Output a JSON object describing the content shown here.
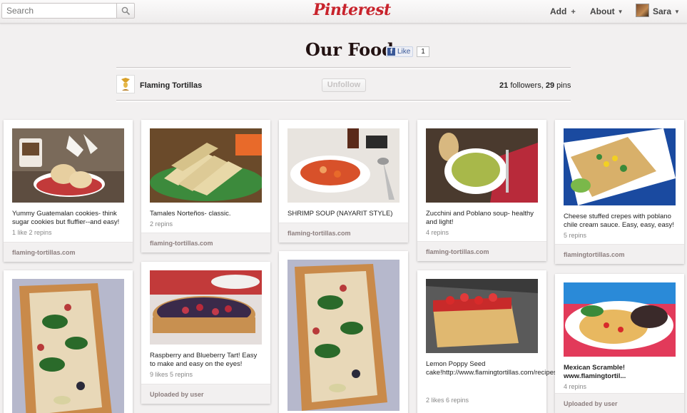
{
  "header": {
    "search_placeholder": "Search",
    "logo": "Pinterest",
    "nav": {
      "add": "Add",
      "add_icon": "+",
      "about": "About",
      "user": "Sara"
    }
  },
  "board": {
    "title": "Our Food",
    "like_label": "Like",
    "like_count": "1",
    "owner": "Flaming Tortillas",
    "unfollow_label": "Unfollow",
    "followers": "21",
    "followers_label": "followers,",
    "pins": "29",
    "pins_label": "pins"
  },
  "pins": [
    {
      "desc": "Yummy Guatemalan cookies- think sugar cookies but fluffier--and easy!",
      "meta": "1 like  2 repins",
      "source": "flaming-tortillas.com"
    },
    {
      "desc": "Tamales Norteños- classic.",
      "meta": "2 repins",
      "source": "flaming-tortillas.com"
    },
    {
      "desc": "SHRIMP SOUP (NAYARIT STYLE)",
      "meta": "",
      "source": "flaming-tortillas.com"
    },
    {
      "desc": "Zucchini and Poblano soup- healthy and light!",
      "meta": "4 repins",
      "source": "flaming-tortillas.com"
    },
    {
      "desc": "Cheese stuffed crepes with poblano chile cream sauce. Easy, easy, easy!",
      "meta": "5 repins",
      "source": "flamingtortillas.com"
    },
    {
      "desc": "",
      "meta": "",
      "source": ""
    },
    {
      "desc": "Raspberry and Blueberry Tart! Easy to make and easy on the eyes!",
      "meta": "9 likes  5 repins",
      "source": "Uploaded by user"
    },
    {
      "desc": "",
      "meta": "",
      "source": ""
    },
    {
      "desc": "Lemon Poppy Seed cake!http://www.flamingtortillas.com/recipes/cakes/lemon_poppyseed_pound_cake",
      "meta": "2 likes  6 repins",
      "source": ""
    },
    {
      "desc": "Mexican Scramble! www.flamingtortil...",
      "meta": "4 repins",
      "source": "Uploaded by user"
    }
  ]
}
